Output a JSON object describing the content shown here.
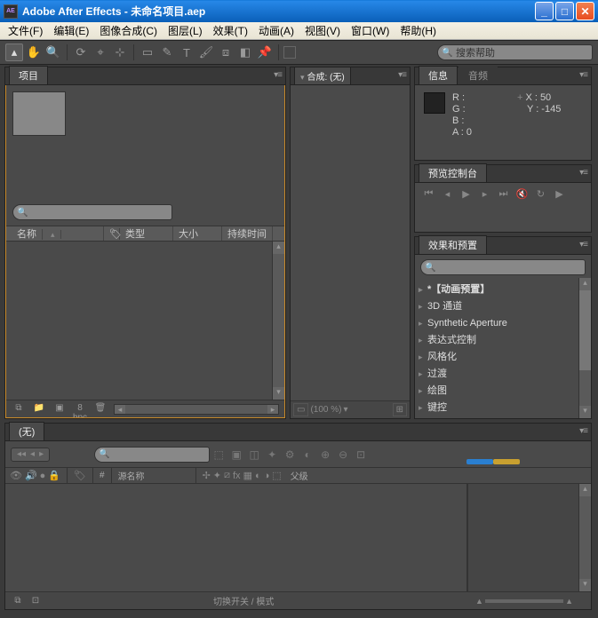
{
  "titlebar": {
    "app_icon": "AE",
    "title": "Adobe After Effects - 未命名项目.aep"
  },
  "menubar": [
    "文件(F)",
    "编辑(E)",
    "图像合成(C)",
    "图层(L)",
    "效果(T)",
    "动画(A)",
    "视图(V)",
    "窗口(W)",
    "帮助(H)"
  ],
  "toolbar": {
    "search_placeholder": "搜索帮助"
  },
  "project": {
    "tab": "项目",
    "search_placeholder": "",
    "cols": {
      "name": "名称",
      "type": "类型",
      "size": "大小",
      "duration": "持续时间"
    },
    "footer_bpc": "8 bpc"
  },
  "comp": {
    "tab": "合成: (无)",
    "zoom": "(100 %)"
  },
  "info": {
    "tab_info": "信息",
    "tab_audio": "音频",
    "r": "R :",
    "g": "G :",
    "b": "B :",
    "a": "A : 0",
    "x": "X : 50",
    "y": "Y : -145"
  },
  "preview": {
    "tab": "预览控制台"
  },
  "effects": {
    "tab": "效果和预置",
    "items": [
      "*【动画预置】",
      "3D 通道",
      "Synthetic Aperture",
      "表达式控制",
      "风格化",
      "过渡",
      "绘图",
      "键控"
    ]
  },
  "timeline": {
    "tab": "(无)",
    "cols": {
      "num": "#",
      "source": "源名称",
      "parent": "父级"
    },
    "footer_label": "切换开关 / 模式"
  }
}
